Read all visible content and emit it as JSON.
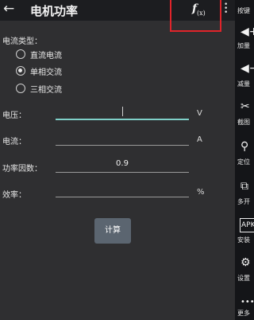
{
  "header": {
    "back_icon": "←",
    "title": "电机功率",
    "fx_label": "f",
    "fx_sub": "(x)"
  },
  "form": {
    "current_type_label": "电流类型：",
    "options": [
      {
        "label": "直流电流",
        "selected": false
      },
      {
        "label": "单相交流",
        "selected": true
      },
      {
        "label": "三相交流",
        "selected": false
      }
    ],
    "voltage": {
      "label": "电压：",
      "value": "",
      "unit": "V"
    },
    "current": {
      "label": "电流：",
      "value": "",
      "unit": "A"
    },
    "power_factor": {
      "label": "功率因数：",
      "value": "0.9"
    },
    "efficiency": {
      "label": "效率：",
      "value": "",
      "unit": "%"
    },
    "calculate_label": "计算"
  },
  "sidebar": {
    "items": [
      {
        "icon": "keys-icon",
        "label": "按键"
      },
      {
        "icon": "volume-up-icon",
        "label": "加量"
      },
      {
        "icon": "volume-down-icon",
        "label": "减量"
      },
      {
        "icon": "scissors-icon",
        "label": "截图"
      },
      {
        "icon": "location-pin-icon",
        "label": "定位"
      },
      {
        "icon": "multi-window-icon",
        "label": "多开"
      },
      {
        "icon": "apk-install-icon",
        "label": "安装"
      },
      {
        "icon": "gear-icon",
        "label": "设置"
      },
      {
        "icon": "more-dots-icon",
        "label": "更多"
      }
    ]
  }
}
